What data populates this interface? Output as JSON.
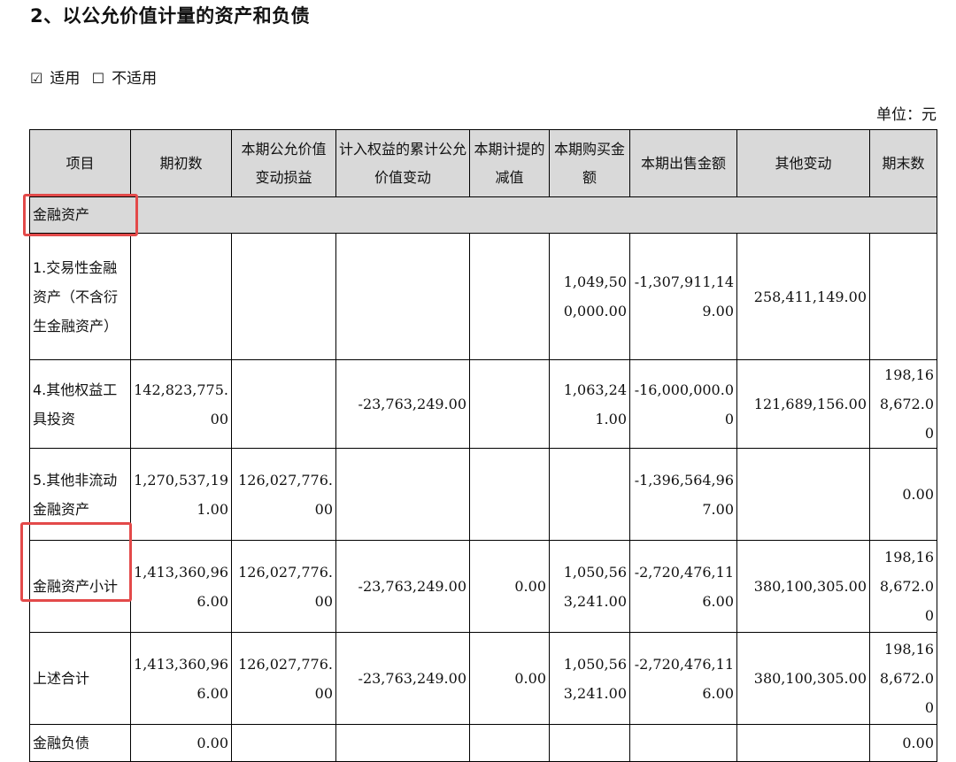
{
  "heading": "2、以公允价值计量的资产和负债",
  "options": {
    "applicable_box": "☑",
    "applicable": "适用",
    "not_applicable_box": "☐",
    "not_applicable": "不适用"
  },
  "unit": "单位：元",
  "table": {
    "headers": {
      "item": "项目",
      "opening": "期初数",
      "fv_change": "本期公允价值变动损益",
      "equity_fv": "计入权益的累计公允价值变动",
      "impairment": "本期计提的减值",
      "purchase": "本期购买金额",
      "sale": "本期出售金额",
      "other": "其他变动",
      "closing": "期末数"
    },
    "section_assets": "金融资产",
    "rows": [
      {
        "item": "1.交易性金融资产（不含衍生金融资产）",
        "opening": "",
        "fv_change": "",
        "equity_fv": "",
        "impairment": "",
        "purchase": "1,049,500,000.00",
        "sale": "-1,307,911,149.00",
        "other": "258,411,149.00",
        "closing": ""
      },
      {
        "item": "4.其他权益工具投资",
        "opening": "142,823,775.00",
        "fv_change": "",
        "equity_fv": "-23,763,249.00",
        "impairment": "",
        "purchase": "1,063,241.00",
        "sale": "-16,000,000.00",
        "other": "121,689,156.00",
        "closing": "198,168,672.00"
      },
      {
        "item": "5.其他非流动金融资产",
        "opening": "1,270,537,191.00",
        "fv_change": "126,027,776.00",
        "equity_fv": "",
        "impairment": "",
        "purchase": "",
        "sale": "-1,396,564,967.00",
        "other": "",
        "closing": "0.00"
      },
      {
        "item": "金融资产小计",
        "opening": "1,413,360,966.00",
        "fv_change": "126,027,776.00",
        "equity_fv": "-23,763,249.00",
        "impairment": "0.00",
        "purchase": "1,050,563,241.00",
        "sale": "-2,720,476,116.00",
        "other": "380,100,305.00",
        "closing": "198,168,672.00"
      },
      {
        "item": "上述合计",
        "opening": "1,413,360,966.00",
        "fv_change": "126,027,776.00",
        "equity_fv": "-23,763,249.00",
        "impairment": "0.00",
        "purchase": "1,050,563,241.00",
        "sale": "-2,720,476,116.00",
        "other": "380,100,305.00",
        "closing": "198,168,672.00"
      },
      {
        "item": "金融负债",
        "opening": "0.00",
        "fv_change": "",
        "equity_fv": "",
        "impairment": "",
        "purchase": "",
        "sale": "",
        "other": "",
        "closing": "0.00"
      }
    ]
  },
  "highlight_color": "#e34a4a"
}
